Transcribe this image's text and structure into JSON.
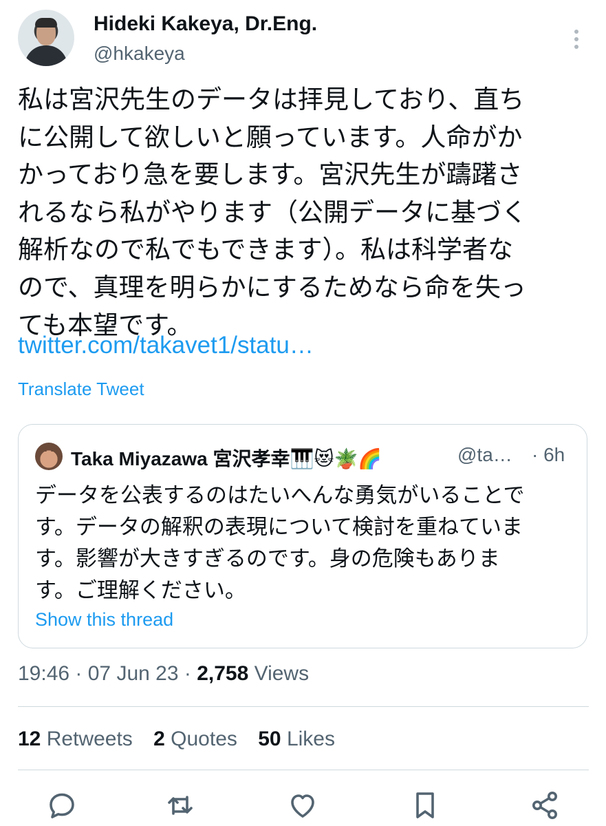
{
  "author": {
    "display_name": "Hideki Kakeya, Dr.Eng.",
    "handle": "@hkakeya"
  },
  "tweet": {
    "text": "私は宮沢先生のデータは拝見しており、直ち\nに公開して欲しいと願っています。人命がか\nかっており急を要します。宮沢先生が躊躇さ\nれるなら私がやります（公開データに基づく\n解析なので私でもできます）。私は科学者な\nので、真理を明らかにするためなら命を失っ\nても本望です。",
    "link": "twitter.com/takavet1/statu…",
    "translate_label": "Translate Tweet"
  },
  "quoted_tweet": {
    "display_name": "Taka Miyazawa 宮沢孝幸🎹😻🪴🌈",
    "handle": "@ta…",
    "time": "· 6h",
    "text": "データを公表するのはたいへんな勇気がいることで\nす。データの解釈の表現について検討を重ねていま\nす。影響が大きすぎるのです。身の危険もありま\nす。ご理解ください。",
    "show_thread": "Show this thread"
  },
  "meta": {
    "datetime": "19:46 · 07 Jun 23 ·",
    "views_count": "2,758",
    "views_label": "Views"
  },
  "stats": {
    "retweets_count": "12",
    "retweets_label": "Retweets",
    "quotes_count": "2",
    "quotes_label": "Quotes",
    "likes_count": "50",
    "likes_label": "Likes"
  },
  "icons": {
    "more": "more-vertical-icon",
    "reply": "reply-icon",
    "retweet": "retweet-icon",
    "like": "heart-icon",
    "bookmark": "bookmark-icon",
    "share": "share-icon"
  },
  "colors": {
    "link": "#1d9bf0",
    "secondary_text": "#536471",
    "primary_text": "#0f1419",
    "border": "#cfd9de"
  }
}
